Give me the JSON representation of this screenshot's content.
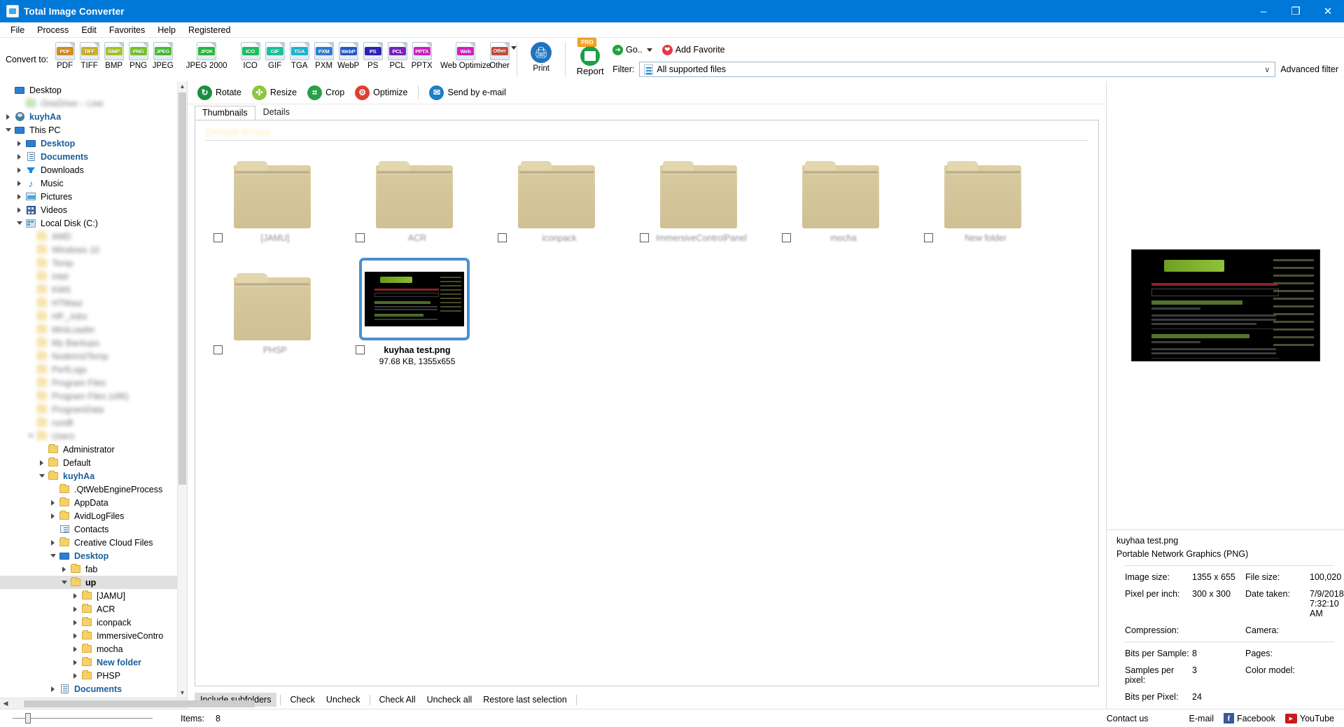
{
  "window": {
    "title": "Total Image Converter",
    "app_icon": "image-file-icon",
    "minimize": "–",
    "maximize": "❐",
    "close": "✕"
  },
  "menubar": {
    "items": [
      {
        "label": "File"
      },
      {
        "label": "Process"
      },
      {
        "label": "Edit"
      },
      {
        "label": "Favorites"
      },
      {
        "label": "Help"
      },
      {
        "label": "Registered"
      }
    ]
  },
  "convert_bar": {
    "label": "Convert to:",
    "formats": [
      {
        "label": "PDF",
        "badge": "PDF",
        "color": "#d68b1c"
      },
      {
        "label": "TIFF",
        "badge": "TIFF",
        "color": "#c9b325"
      },
      {
        "label": "BMP",
        "badge": "BMP",
        "color": "#a8c426"
      },
      {
        "label": "PNG",
        "badge": "PNG",
        "color": "#76c32a"
      },
      {
        "label": "JPEG",
        "badge": "JPEG",
        "color": "#46bd2e"
      },
      {
        "label": "JPEG 2000",
        "badge": "JP2K",
        "color": "#24b93a"
      },
      {
        "label": "ICO",
        "badge": "ICO",
        "color": "#18bf62"
      },
      {
        "label": "GIF",
        "badge": "GIF",
        "color": "#17c39a"
      },
      {
        "label": "TGA",
        "badge": "TGA",
        "color": "#19b5d4"
      },
      {
        "label": "PXM",
        "badge": "PXM",
        "color": "#2a7fd6"
      },
      {
        "label": "WebP",
        "badge": "WebP",
        "color": "#2457c9"
      },
      {
        "label": "PS",
        "badge": "PS",
        "color": "#2f22b5"
      },
      {
        "label": "PCL",
        "badge": "PCL",
        "color": "#7a1fc0"
      },
      {
        "label": "PPTX",
        "badge": "PPTX",
        "color": "#d41ec2"
      }
    ],
    "web_format": {
      "label": "Web Optimize",
      "badge": "Web",
      "color": "#d41ec2"
    },
    "other_format": {
      "label": "Other",
      "badge": "Other",
      "color": "#c94a3a"
    },
    "print_button": {
      "label": "Print",
      "icon": "printer-icon",
      "color": "#1f74c0"
    },
    "report_button": {
      "label": "Report",
      "icon": "report-icon",
      "color": "#1e9e48",
      "badge": "PRO"
    }
  },
  "nav_bar": {
    "go_label": "Go..",
    "go_icon": "go-arrow-icon",
    "go_color": "#21a13b",
    "add_favorite_label": "Add Favorite",
    "favorite_icon": "heart-icon",
    "favorite_color": "#e23a4b",
    "filter_label": "Filter:",
    "filter_value": "All supported files",
    "filter_icon": "file-type-icon",
    "filter_chevron": "∨",
    "advanced_filter_label": "Advanced filter"
  },
  "action_bar": {
    "actions": [
      {
        "label": "Rotate",
        "icon": "rotate-icon",
        "glyph": "↻",
        "color": "#1b8f3f"
      },
      {
        "label": "Resize",
        "icon": "resize-icon",
        "glyph": "✥",
        "color": "#8dc63f"
      },
      {
        "label": "Crop",
        "icon": "crop-icon",
        "glyph": "⌗",
        "color": "#2a9e48"
      },
      {
        "label": "Optimize",
        "icon": "optimize-icon",
        "glyph": "⚙",
        "color": "#e03e30"
      }
    ],
    "send_email": {
      "label": "Send by e-mail",
      "icon": "envelope-icon",
      "glyph": "✉",
      "color": "#1d7fc7"
    }
  },
  "tabs": [
    {
      "label": "Thumbnails",
      "active": true
    },
    {
      "label": "Details",
      "active": false
    }
  ],
  "tree": {
    "items": [
      {
        "label": "Desktop",
        "indent": 0,
        "twisty": "none",
        "icon": "monitor-icon",
        "style": "plain"
      },
      {
        "label": "OneDrive – Live",
        "indent": 1,
        "twisty": "none",
        "icon": "cloud-icon",
        "style": "blur"
      },
      {
        "label": "kuyhAa",
        "indent": 0,
        "twisty": "right",
        "icon": "user-icon",
        "style": "blue"
      },
      {
        "label": "This PC",
        "indent": 0,
        "twisty": "down",
        "icon": "monitor-icon",
        "style": "plain"
      },
      {
        "label": "Desktop",
        "indent": 1,
        "twisty": "right",
        "icon": "monitor-icon",
        "style": "blue"
      },
      {
        "label": "Documents",
        "indent": 1,
        "twisty": "right",
        "icon": "doc-icon",
        "style": "blue"
      },
      {
        "label": "Downloads",
        "indent": 1,
        "twisty": "right",
        "icon": "download-icon",
        "style": "plain"
      },
      {
        "label": "Music",
        "indent": 1,
        "twisty": "right",
        "icon": "music-icon",
        "style": "plain"
      },
      {
        "label": "Pictures",
        "indent": 1,
        "twisty": "right",
        "icon": "picture-icon",
        "style": "plain"
      },
      {
        "label": "Videos",
        "indent": 1,
        "twisty": "right",
        "icon": "video-icon",
        "style": "plain"
      },
      {
        "label": "Local Disk (C:)",
        "indent": 1,
        "twisty": "down",
        "icon": "disk-icon",
        "style": "plain"
      },
      {
        "label": "AMD",
        "indent": 2,
        "twisty": "none",
        "icon": "folder-icon",
        "style": "blur"
      },
      {
        "label": "Windows 10",
        "indent": 2,
        "twisty": "none",
        "icon": "folder-icon",
        "style": "blur"
      },
      {
        "label": "Temp",
        "indent": 2,
        "twisty": "none",
        "icon": "folder-icon",
        "style": "blur"
      },
      {
        "label": "Intel",
        "indent": 2,
        "twisty": "none",
        "icon": "folder-icon",
        "style": "blur"
      },
      {
        "label": "KMS",
        "indent": 2,
        "twisty": "none",
        "icon": "folder-icon",
        "style": "blur"
      },
      {
        "label": "HTMaui",
        "indent": 2,
        "twisty": "none",
        "icon": "folder-icon",
        "style": "blur"
      },
      {
        "label": "HP_Jobs",
        "indent": 2,
        "twisty": "none",
        "icon": "folder-icon",
        "style": "blur"
      },
      {
        "label": "MiniLoader",
        "indent": 2,
        "twisty": "none",
        "icon": "folder-icon",
        "style": "blur"
      },
      {
        "label": "My Backups",
        "indent": 2,
        "twisty": "none",
        "icon": "folder-icon",
        "style": "blur"
      },
      {
        "label": "NodeInstTemp",
        "indent": 2,
        "twisty": "none",
        "icon": "folder-icon",
        "style": "blur"
      },
      {
        "label": "PerfLogs",
        "indent": 2,
        "twisty": "none",
        "icon": "folder-icon",
        "style": "blur"
      },
      {
        "label": "Program Files",
        "indent": 2,
        "twisty": "none",
        "icon": "folder-icon",
        "style": "blur"
      },
      {
        "label": "Program Files (x86)",
        "indent": 2,
        "twisty": "none",
        "icon": "folder-icon",
        "style": "blur"
      },
      {
        "label": "ProgramData",
        "indent": 2,
        "twisty": "none",
        "icon": "folder-icon",
        "style": "blur"
      },
      {
        "label": "rundll",
        "indent": 2,
        "twisty": "none",
        "icon": "folder-icon",
        "style": "blur"
      },
      {
        "label": "Users",
        "indent": 2,
        "twisty": "down",
        "icon": "folder-icon",
        "style": "blur"
      },
      {
        "label": "Administrator",
        "indent": 3,
        "twisty": "none",
        "icon": "folder-icon",
        "style": "plain"
      },
      {
        "label": "Default",
        "indent": 3,
        "twisty": "right",
        "icon": "folder-icon",
        "style": "plain"
      },
      {
        "label": "kuyhAa",
        "indent": 3,
        "twisty": "down",
        "icon": "folder-icon",
        "style": "blue"
      },
      {
        "label": ".QtWebEngineProcess",
        "indent": 4,
        "twisty": "none",
        "icon": "folder-icon",
        "style": "plain"
      },
      {
        "label": "AppData",
        "indent": 4,
        "twisty": "right",
        "icon": "folder-icon",
        "style": "plain"
      },
      {
        "label": "AvidLogFiles",
        "indent": 4,
        "twisty": "right",
        "icon": "folder-icon",
        "style": "plain"
      },
      {
        "label": "Contacts",
        "indent": 4,
        "twisty": "none",
        "icon": "contacts-icon",
        "style": "plain"
      },
      {
        "label": "Creative Cloud Files",
        "indent": 4,
        "twisty": "right",
        "icon": "folder-icon",
        "style": "plain"
      },
      {
        "label": "Desktop",
        "indent": 4,
        "twisty": "down",
        "icon": "monitor-icon",
        "style": "blue"
      },
      {
        "label": "fab",
        "indent": 5,
        "twisty": "right",
        "icon": "folder-icon",
        "style": "plain"
      },
      {
        "label": "up",
        "indent": 5,
        "twisty": "down",
        "icon": "folder-icon",
        "style": "bold",
        "selected": true
      },
      {
        "label": "[JAMU]",
        "indent": 6,
        "twisty": "right",
        "icon": "folder-icon",
        "style": "plain"
      },
      {
        "label": "ACR",
        "indent": 6,
        "twisty": "right",
        "icon": "folder-icon",
        "style": "plain"
      },
      {
        "label": "iconpack",
        "indent": 6,
        "twisty": "right",
        "icon": "folder-icon",
        "style": "plain"
      },
      {
        "label": "ImmersiveContro",
        "indent": 6,
        "twisty": "right",
        "icon": "folder-icon",
        "style": "plain"
      },
      {
        "label": "mocha",
        "indent": 6,
        "twisty": "right",
        "icon": "folder-icon",
        "style": "plain"
      },
      {
        "label": "New folder",
        "indent": 6,
        "twisty": "right",
        "icon": "folder-icon",
        "style": "blue"
      },
      {
        "label": "PHSP",
        "indent": 6,
        "twisty": "right",
        "icon": "folder-icon",
        "style": "plain"
      },
      {
        "label": "Documents",
        "indent": 4,
        "twisty": "right",
        "icon": "doc-icon",
        "style": "blue"
      }
    ]
  },
  "file_list": {
    "group_header": "Default Group",
    "items": [
      {
        "name": "[JAMU]",
        "type": "folder",
        "checked": false
      },
      {
        "name": "ACR",
        "type": "folder",
        "checked": false
      },
      {
        "name": "iconpack",
        "type": "folder",
        "checked": false
      },
      {
        "name": "ImmersiveControlPanel",
        "type": "folder",
        "checked": false
      },
      {
        "name": "mocha",
        "type": "folder",
        "checked": false
      },
      {
        "name": "New folder",
        "type": "folder",
        "checked": false
      },
      {
        "name": "PHSP",
        "type": "folder",
        "checked": false
      },
      {
        "name": "kuyhaa test.png",
        "type": "image",
        "checked": false,
        "selected": true,
        "meta": "97.68 KB, 1355x655"
      }
    ]
  },
  "list_toolbar": {
    "buttons": [
      {
        "label": "Include subfolders",
        "active": true
      },
      {
        "label": "Check",
        "active": false
      },
      {
        "label": "Uncheck",
        "active": false
      },
      {
        "label": "Check All",
        "active": false
      },
      {
        "label": "Uncheck all",
        "active": false
      },
      {
        "label": "Restore last selection",
        "active": false
      }
    ]
  },
  "properties": {
    "file_name": "kuyhaa test.png",
    "file_type": "Portable Network Graphics (PNG)",
    "rows": [
      {
        "k1": "Image size:",
        "v1": "1355 x 655",
        "k2": "File size:",
        "v2": "100,020"
      },
      {
        "k1": "Pixel per inch:",
        "v1": "300 x 300",
        "k2": "Date taken:",
        "v2": "7/9/2018 7:32:10 AM"
      },
      {
        "k1": "Compression:",
        "v1": "",
        "k2": "Camera:",
        "v2": ""
      }
    ],
    "rows2": [
      {
        "k1": "Bits per Sample:",
        "v1": "8",
        "k2": "Pages:",
        "v2": ""
      },
      {
        "k1": "Samples per pixel:",
        "v1": "3",
        "k2": "Color model:",
        "v2": ""
      },
      {
        "k1": "Bits per Pixel:",
        "v1": "24",
        "k2": "",
        "v2": ""
      }
    ]
  },
  "status_bar": {
    "items_label": "Items:",
    "items_count": "8",
    "contact_us": "Contact us",
    "email": "E-mail",
    "facebook": "Facebook",
    "youtube": "YouTube",
    "fb_glyph": "f",
    "yt_glyph": "▶"
  }
}
